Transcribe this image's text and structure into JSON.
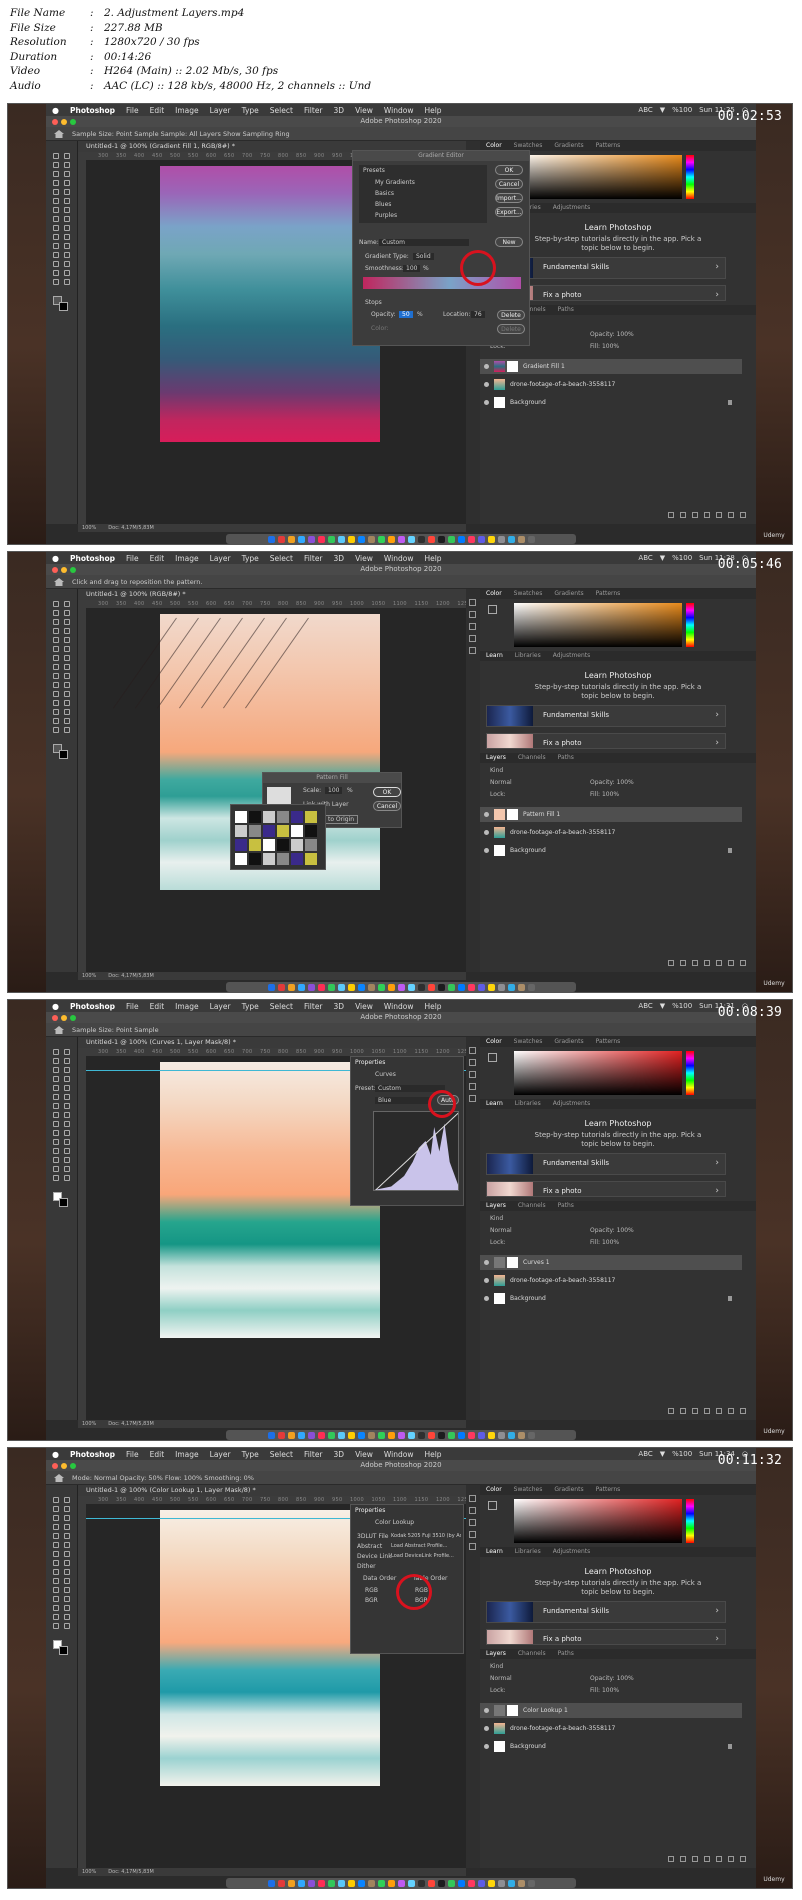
{
  "file_info": [
    {
      "key": "File Name",
      "value": "2. Adjustment Layers.mp4"
    },
    {
      "key": "File Size",
      "value": "227.88 MB"
    },
    {
      "key": "Resolution",
      "value": "1280x720 / 30 fps"
    },
    {
      "key": "Duration",
      "value": "00:14:26"
    },
    {
      "key": "Video",
      "value": "H264 (Main) :: 2.02 Mb/s, 30 fps"
    },
    {
      "key": "Audio",
      "value": "AAC (LC) :: 128 kb/s, 48000 Hz, 2 channels :: Und"
    }
  ],
  "separator": ":",
  "app": {
    "name": "Photoshop",
    "window_title": "Adobe Photoshop 2020",
    "menu": [
      "File",
      "Edit",
      "Image",
      "Layer",
      "Type",
      "Select",
      "Filter",
      "3D",
      "View",
      "Window",
      "Help"
    ],
    "zoom": "100%",
    "doc_size": "Doc: 4,17M/5,83M",
    "status_pct": "%100",
    "abc": "ABC",
    "ruler": "300    350    400    450    500    550    600    650    700    750    800    850    900    950    1000    1050    1100    1150    1200    1250    1300    1350    1400"
  },
  "panels": {
    "color_tabs": [
      "Color",
      "Swatches",
      "Gradients",
      "Patterns"
    ],
    "learn_tabs": [
      "Learn",
      "Libraries",
      "Adjustments"
    ],
    "layers_tabs": [
      "Layers",
      "Channels",
      "Paths"
    ],
    "learn_title": "Learn Photoshop",
    "learn_sub_1": "Step-by-step tutorials directly in the app. Pick a",
    "learn_sub_2": "topic below to begin.",
    "card1": "Fundamental Skills",
    "card2": "Fix a photo",
    "kind": "Kind",
    "normal": "Normal",
    "opacity": "Opacity: 100%",
    "lock": "Lock:",
    "fill": "Fill: 100%",
    "layer_drone": "drone-footage-of-a-beach-3558117",
    "layer_bg": "Background"
  },
  "udemy": "Udemy",
  "frames": [
    {
      "timecode": "00:02:53",
      "time": "Sun 11:25",
      "tab": "Untitled-1 @ 100% (Gradient Fill 1, RGB/8#) *",
      "options": "Sample Size:   Point Sample       Sample:   All Layers         Show Sampling Ring",
      "top_layer": "Gradient Fill 1",
      "gradient_editor": {
        "title": "Gradient Editor",
        "presets_label": "Presets",
        "presets": [
          "My Gradients",
          "Basics",
          "Blues",
          "Purples"
        ],
        "ok": "OK",
        "cancel": "Cancel",
        "import": "Import...",
        "export": "Export...",
        "new": "New",
        "name_label": "Name:",
        "name_value": "Custom",
        "type_label": "Gradient Type:",
        "type_value": "Solid",
        "smooth_label": "Smoothness:",
        "smooth_value": "100",
        "pct": "%",
        "stops": "Stops",
        "opacity_label": "Opacity:",
        "opacity_value": "50",
        "location_label": "Location:",
        "location_value": "76",
        "delete": "Delete",
        "color_label": "Color:"
      }
    },
    {
      "timecode": "00:05:46",
      "time": "Sun 11:28",
      "tab": "Untitled-1 @ 100% (RGB/8#) *",
      "options": "Click and drag to reposition the pattern.",
      "top_layer": "Pattern Fill 1",
      "pattern_fill": {
        "title": "Pattern Fill",
        "scale_label": "Scale:",
        "scale_value": "100",
        "pct": "%",
        "link": "Link with Layer",
        "snap": "Snap to Origin",
        "ok": "OK",
        "cancel": "Cancel"
      }
    },
    {
      "timecode": "00:08:39",
      "time": "Sun 11:31",
      "tab": "Untitled-1 @ 100% (Curves 1, Layer Mask/8) *",
      "options": "Sample Size:   Point Sample",
      "top_layer": "Curves 1",
      "properties": {
        "title": "Properties",
        "kind": "Curves",
        "preset_label": "Preset:",
        "preset_value": "Custom",
        "channel": "Blue",
        "auto": "Auto"
      }
    },
    {
      "timecode": "00:11:32",
      "time": "Sun 11:34",
      "tab": "Untitled-1 @ 100% (Color Lookup 1, Layer Mask/8) *",
      "options": "Mode:   Normal      Opacity:  50%      Flow:  100%      Smoothing:  0%",
      "top_layer": "Color Lookup 1",
      "properties": {
        "title": "Properties",
        "kind": "Color Lookup",
        "r1_label": "3DLUT File",
        "r1_value": "Kodak 5205 Fuji 3510 (by Adob...",
        "r2_label": "Abstract",
        "r2_value": "Load Abstract Profile...",
        "r3_label": "Device Link",
        "r3_value": "Load DeviceLink Profile...",
        "dither": "Dither",
        "data_order": "Data Order",
        "table_order": "Table Order",
        "rgb": "RGB",
        "bgr": "BGR"
      }
    }
  ]
}
